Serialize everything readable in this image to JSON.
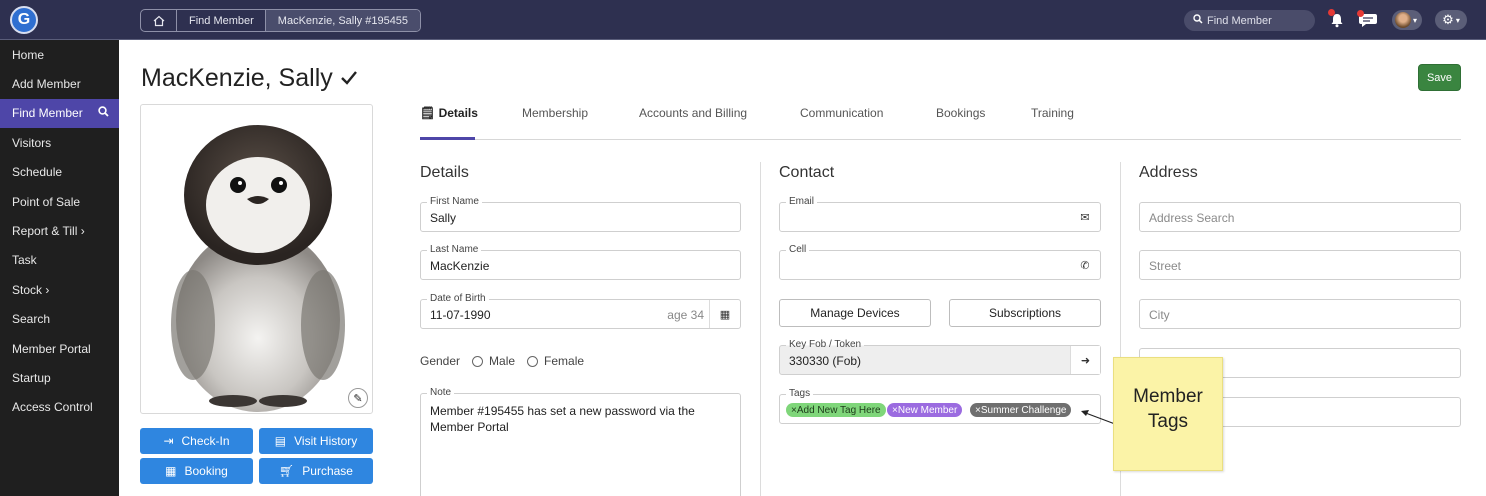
{
  "topbar": {
    "logo_letter": "G",
    "breadcrumb": [
      "Find Member",
      "MacKenzie, Sally #195455"
    ],
    "search_placeholder": "Find Member",
    "accent": "#2e3050"
  },
  "sidebar": {
    "items": [
      {
        "label": "Home"
      },
      {
        "label": "Add Member"
      },
      {
        "label": "Find Member",
        "active": true
      },
      {
        "label": "Visitors"
      },
      {
        "label": "Schedule"
      },
      {
        "label": "Point of Sale"
      },
      {
        "label": "Report & Till ›"
      },
      {
        "label": "Task"
      },
      {
        "label": "Stock ›"
      },
      {
        "label": "Search"
      },
      {
        "label": "Member Portal"
      },
      {
        "label": "Startup"
      },
      {
        "label": "Access Control"
      }
    ],
    "active_color": "#4e46a8"
  },
  "member": {
    "name": "MacKenzie, Sally",
    "save_label": "Save"
  },
  "actions": {
    "checkin": "Check-In",
    "visit_history": "Visit History",
    "booking": "Booking",
    "purchase": "Purchase"
  },
  "tabs": [
    "Details",
    "Membership",
    "Accounts and Billing",
    "Communication",
    "Bookings",
    "Training"
  ],
  "details": {
    "title": "Details",
    "first_name_label": "First Name",
    "first_name": "Sally",
    "last_name_label": "Last Name",
    "last_name": "MacKenzie",
    "dob_label": "Date of Birth",
    "dob": "11-07-1990",
    "age": "age 34",
    "gender_label": "Gender",
    "gender_options": [
      "Male",
      "Female"
    ],
    "note_label": "Note",
    "note": "Member #195455 has set a new password via the Member Portal"
  },
  "contact": {
    "title": "Contact",
    "email_label": "Email",
    "email": "",
    "cell_label": "Cell",
    "cell": "",
    "manage_devices": "Manage Devices",
    "subscriptions": "Subscriptions",
    "keyfob_label": "Key Fob / Token",
    "keyfob": "330330 (Fob)",
    "tags_label": "Tags",
    "tags": [
      {
        "label": "Add New Tag Here",
        "color": "#7fd67a",
        "text_color": "#1d3b1a"
      },
      {
        "label": "New Member",
        "color": "#9b6be0",
        "text_color": "#ffffff"
      },
      {
        "label": "Summer Challenge",
        "color": "#6f6f6f",
        "text_color": "#ffffff"
      }
    ]
  },
  "address": {
    "title": "Address",
    "search_placeholder": "Address Search",
    "street_placeholder": "Street",
    "city_placeholder": "City"
  },
  "annotation": {
    "line1": "Member",
    "line2": "Tags"
  }
}
